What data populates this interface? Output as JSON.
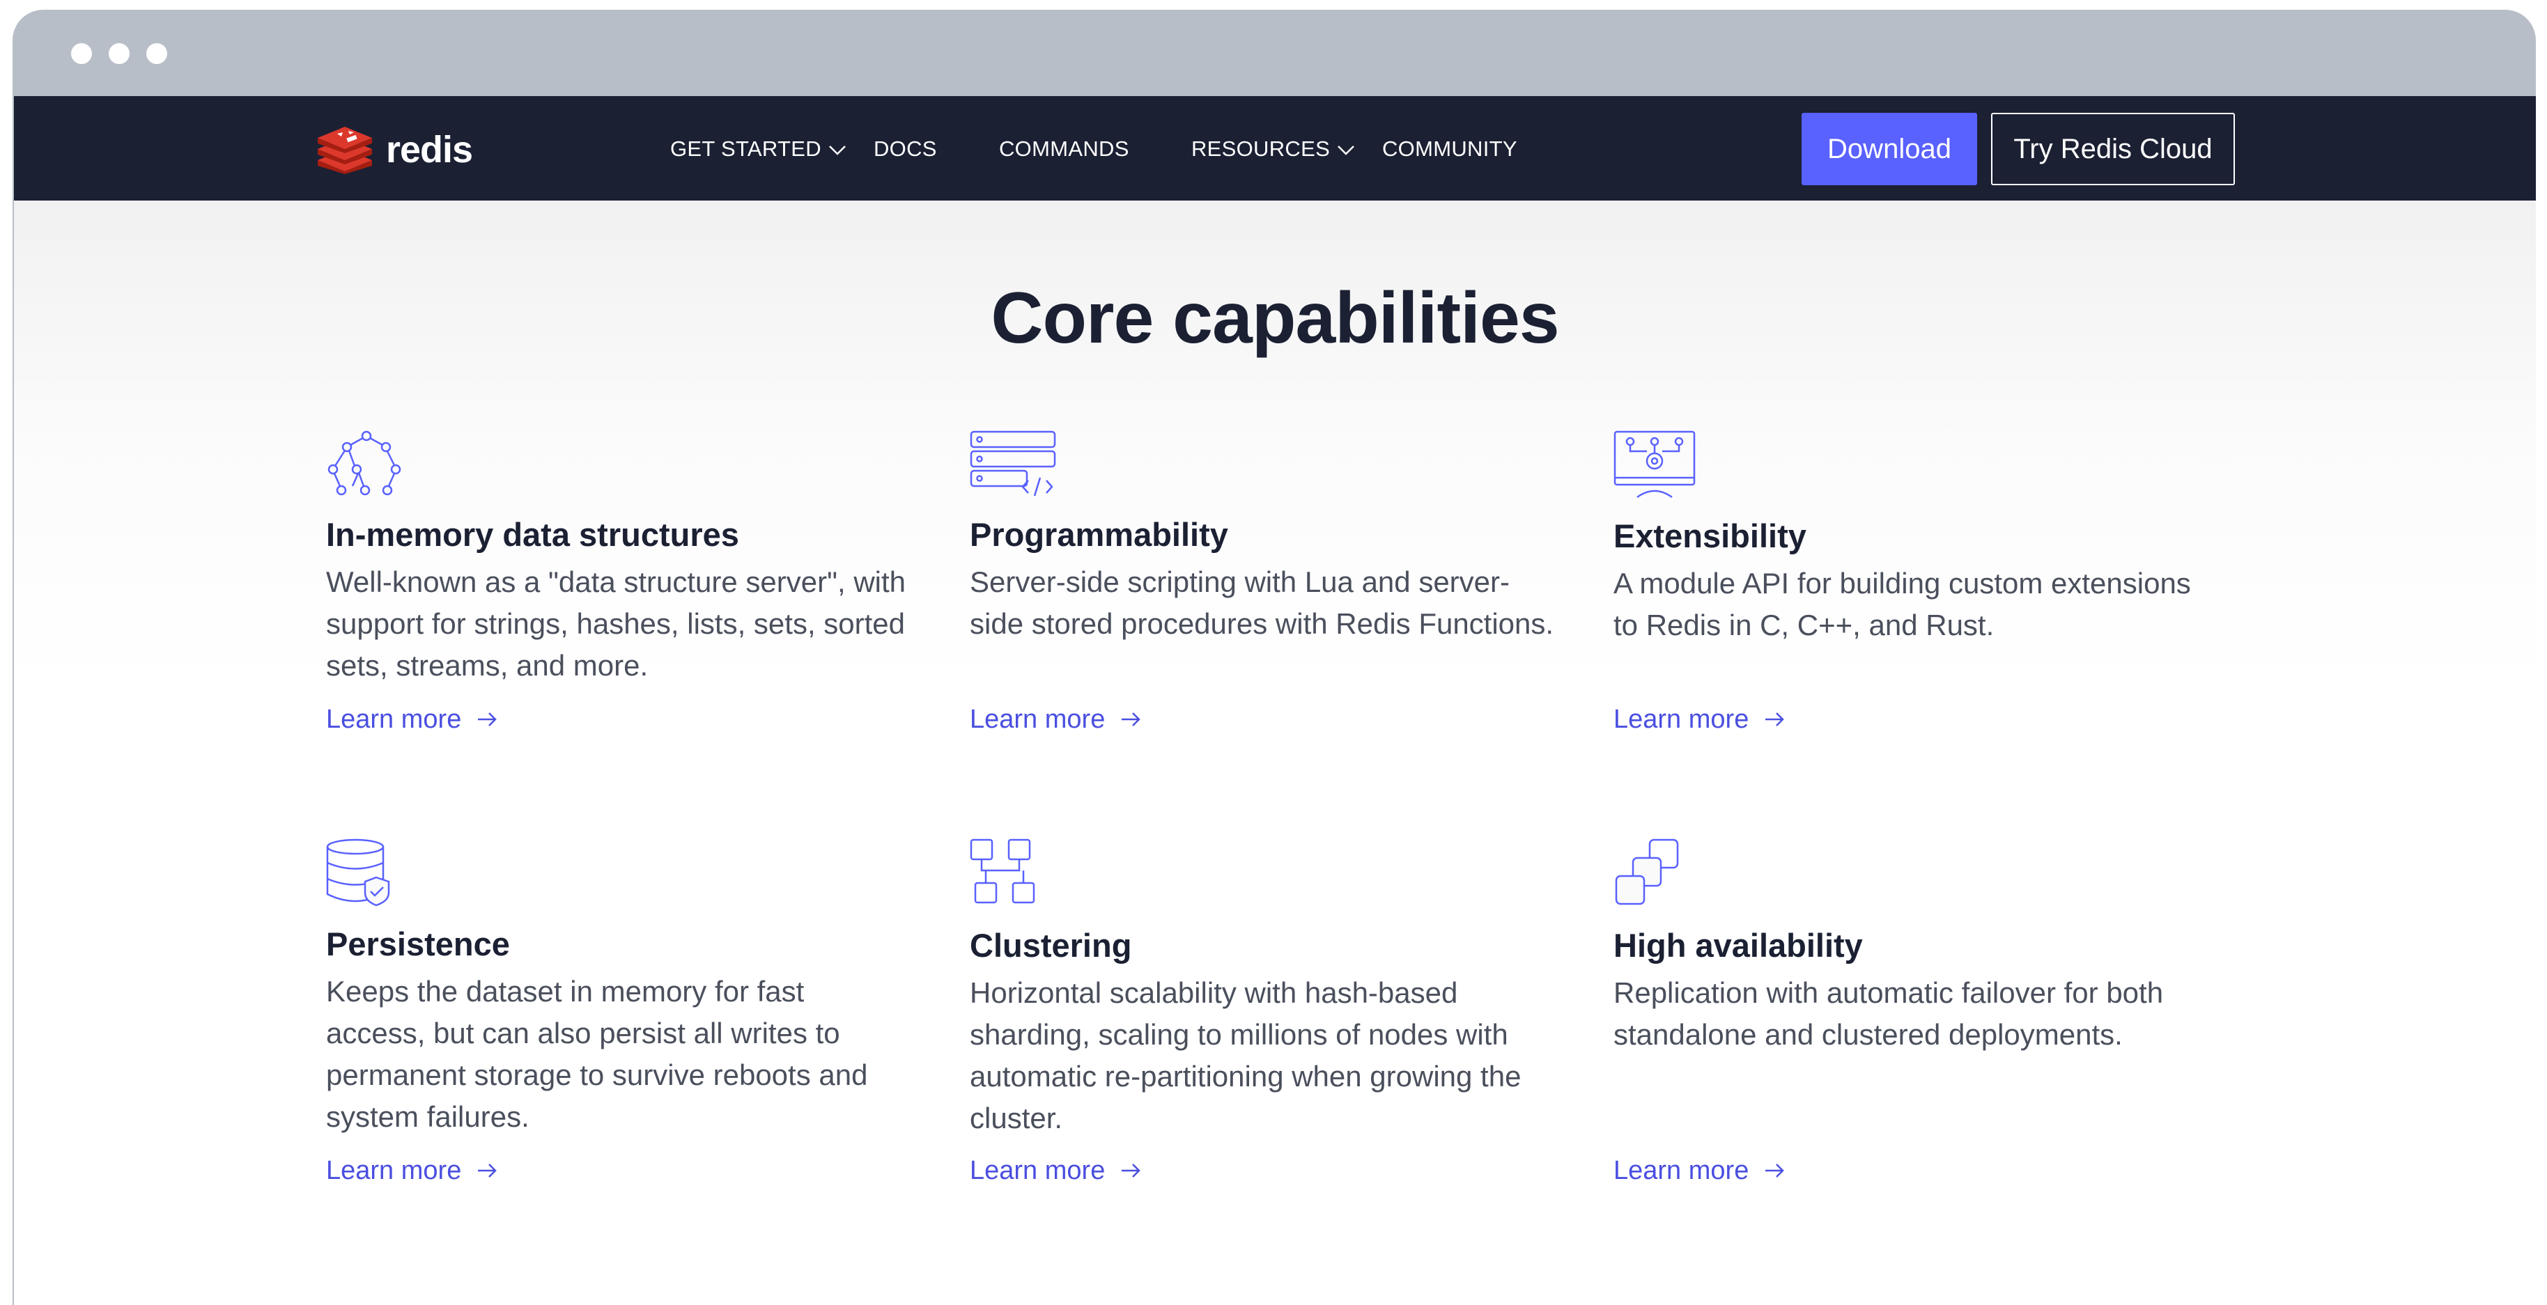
{
  "window": {
    "controls": [
      "close-dot",
      "minimize-dot",
      "maximize-dot"
    ]
  },
  "navbar": {
    "brand": "redis",
    "brand_color": "#dc382c",
    "items": [
      {
        "label": "GET STARTED",
        "has_dropdown": true
      },
      {
        "label": "DOCS",
        "has_dropdown": false
      },
      {
        "label": "COMMANDS",
        "has_dropdown": false
      },
      {
        "label": "RESOURCES",
        "has_dropdown": true
      },
      {
        "label": "COMMUNITY",
        "has_dropdown": false
      }
    ],
    "download_label": "Download",
    "cloud_label": "Try Redis Cloud",
    "background": "#1b2033",
    "accent": "#5961ff"
  },
  "main": {
    "heading": "Core capabilities",
    "link_color": "#4a4fe0",
    "cards": [
      {
        "icon": "tree-structure-icon",
        "title": "In-memory data structures",
        "description": "Well-known as a \"data structure server\", with support for strings, hashes, lists, sets, sorted sets, streams, and more.",
        "link": "Learn more"
      },
      {
        "icon": "server-code-icon",
        "title": "Programmability",
        "description": "Server-side scripting with Lua and server-side stored procedures with Redis Functions.",
        "link": "Learn more"
      },
      {
        "icon": "module-gear-icon",
        "title": "Extensibility",
        "description": "A module API for building custom extensions to Redis in C, C++, and Rust.",
        "link": "Learn more"
      },
      {
        "icon": "database-shield-icon",
        "title": "Persistence",
        "description": "Keeps the dataset in memory for fast access, but can also persist all writes to permanent storage to survive reboots and system failures.",
        "link": "Learn more"
      },
      {
        "icon": "cluster-nodes-icon",
        "title": "Clustering",
        "description": "Horizontal scalability with hash-based sharding, scaling to millions of nodes with automatic re-partitioning when growing the cluster.",
        "link": "Learn more"
      },
      {
        "icon": "replica-squares-icon",
        "title": "High availability",
        "description": "Replication with automatic failover for both standalone and clustered deployments.",
        "link": "Learn more"
      }
    ]
  }
}
